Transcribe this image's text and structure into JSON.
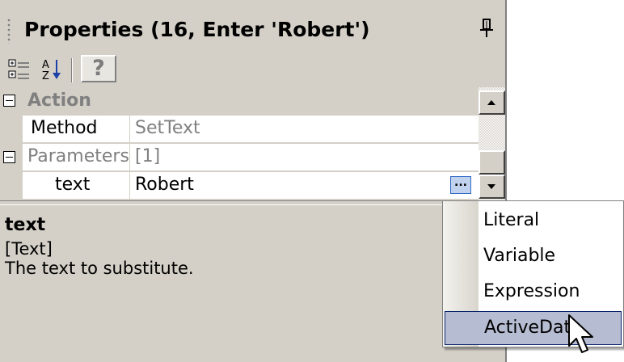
{
  "panel": {
    "title": "Properties (16, Enter 'Robert')"
  },
  "toolbar": {
    "categorized_icon": "categorized-icon",
    "alphabetical_icon": "alphabetical-icon",
    "help_label": "?"
  },
  "grid": {
    "category": "Action",
    "rows": [
      {
        "name": "Method",
        "value": "SetText"
      },
      {
        "name": "Parameters",
        "value": "[1]"
      },
      {
        "name": "text",
        "value": "Robert"
      }
    ],
    "ellipsis_label": "..."
  },
  "description": {
    "title": "text",
    "type": "[Text]",
    "text": "The text to substitute."
  },
  "menu": {
    "items": [
      "Literal",
      "Variable",
      "Expression",
      "ActiveData"
    ],
    "selected": "ActiveData"
  },
  "colors": {
    "panel_bg": "#d4d0c8",
    "selection": "#b6bdd2",
    "selection_border": "#0a246a"
  }
}
